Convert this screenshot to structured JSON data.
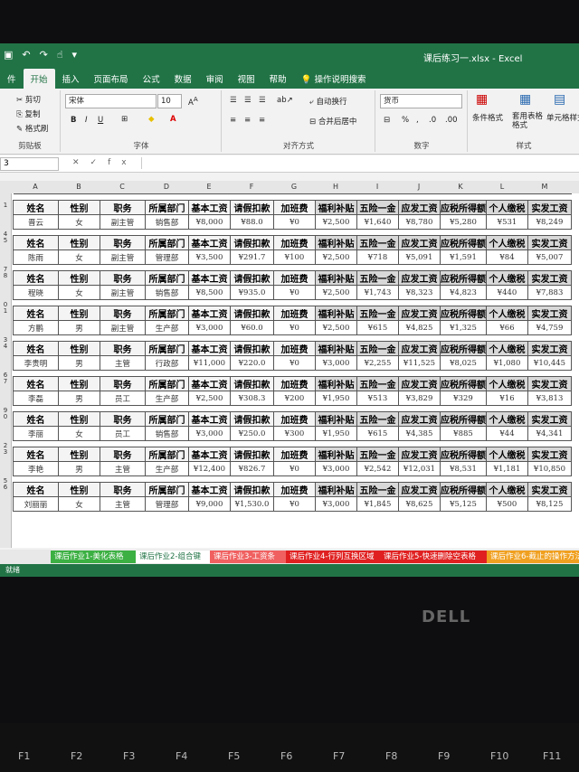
{
  "window": {
    "title": "课后练习一.xlsx - Excel"
  },
  "tabs": [
    "件",
    "开始",
    "插入",
    "页面布局",
    "公式",
    "数据",
    "审阅",
    "视图",
    "帮助",
    "操作说明搜索"
  ],
  "ribbon": {
    "cut": "剪切",
    "copy": "复制",
    "format_painter": "格式刷",
    "clipboard_label": "剪贴板",
    "font_name": "宋体",
    "font_size": "10",
    "font_label": "字体",
    "wrap_text": "自动换行",
    "merge": "合并后居中",
    "align_label": "对齐方式",
    "number_format": "货币",
    "number_label": "数字",
    "cond_format": "条件格式",
    "table_format": "套用表格格式",
    "cell_style": "单元格样式",
    "style_label": "样式"
  },
  "formula_bar": {
    "name_box": "3",
    "fx": "fx"
  },
  "columns": [
    "A",
    "B",
    "C",
    "D",
    "E",
    "F",
    "G",
    "H",
    "I",
    "J",
    "K",
    "L",
    "M"
  ],
  "row_numbers": [
    "",
    "1",
    "",
    "4",
    "5",
    "",
    "7",
    "8",
    "",
    "0",
    "1",
    "",
    "3",
    "4",
    "",
    "6",
    "7",
    "",
    "9",
    "0",
    "",
    "2",
    "3",
    "",
    "5",
    "6",
    "",
    "8"
  ],
  "header_labels": [
    "姓名",
    "性别",
    "职务",
    "所属部门",
    "基本工资",
    "请假扣款",
    "加班费",
    "福利补贴",
    "五险一金",
    "应发工资",
    "应税所得额",
    "个人缴税",
    "实发工资"
  ],
  "records": [
    [
      "晋云",
      "女",
      "副主管",
      "销售部",
      "¥8,000",
      "¥88.0",
      "¥0",
      "¥2,500",
      "¥1,640",
      "¥8,780",
      "¥5,280",
      "¥531",
      "¥8,249"
    ],
    [
      "陈雨",
      "女",
      "副主管",
      "管理部",
      "¥3,500",
      "¥291.7",
      "¥100",
      "¥2,500",
      "¥718",
      "¥5,091",
      "¥1,591",
      "¥84",
      "¥5,007"
    ],
    [
      "程晓",
      "女",
      "副主管",
      "销售部",
      "¥8,500",
      "¥935.0",
      "¥0",
      "¥2,500",
      "¥1,743",
      "¥8,323",
      "¥4,823",
      "¥440",
      "¥7,883"
    ],
    [
      "方鹏",
      "男",
      "副主管",
      "生产部",
      "¥3,000",
      "¥60.0",
      "¥0",
      "¥2,500",
      "¥615",
      "¥4,825",
      "¥1,325",
      "¥66",
      "¥4,759"
    ],
    [
      "李贵明",
      "男",
      "主管",
      "行政部",
      "¥11,000",
      "¥220.0",
      "¥0",
      "¥3,000",
      "¥2,255",
      "¥11,525",
      "¥8,025",
      "¥1,080",
      "¥10,445"
    ],
    [
      "李磊",
      "男",
      "员工",
      "生产部",
      "¥2,500",
      "¥308.3",
      "¥200",
      "¥1,950",
      "¥513",
      "¥3,829",
      "¥329",
      "¥16",
      "¥3,813"
    ],
    [
      "李丽",
      "女",
      "员工",
      "销售部",
      "¥3,000",
      "¥250.0",
      "¥300",
      "¥1,950",
      "¥615",
      "¥4,385",
      "¥885",
      "¥44",
      "¥4,341"
    ],
    [
      "李艳",
      "男",
      "主管",
      "生产部",
      "¥12,400",
      "¥826.7",
      "¥0",
      "¥3,000",
      "¥2,542",
      "¥12,031",
      "¥8,531",
      "¥1,181",
      "¥10,850"
    ],
    [
      "刘丽丽",
      "女",
      "主管",
      "管理部",
      "¥9,000",
      "¥1,530.0",
      "¥0",
      "¥3,000",
      "¥1,845",
      "¥8,625",
      "¥5,125",
      "¥500",
      "¥8,125"
    ]
  ],
  "sheet_tabs": [
    {
      "label": "课后作业1-美化表格",
      "color": "#3cb043"
    },
    {
      "label": "课后作业2-组合键",
      "color": "#ffffff"
    },
    {
      "label": "课后作业3-工资条",
      "color": "#f06060"
    },
    {
      "label": "课后作业4-行列互换区域",
      "color": "#e02020"
    },
    {
      "label": "课后作业5-快速删除空表格",
      "color": "#e02020"
    },
    {
      "label": "课后作业6-截止的操作方法",
      "color": "#f0a020"
    }
  ],
  "status": {
    "text": "就绪"
  },
  "bezel": {
    "logo": "DELL"
  },
  "fkeys": [
    "F1",
    "F2",
    "F3",
    "F4",
    "F5",
    "F6",
    "F7",
    "F8",
    "F9",
    "F10",
    "F11"
  ]
}
